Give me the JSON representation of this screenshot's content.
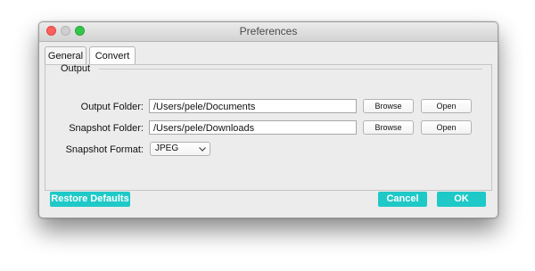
{
  "window": {
    "title": "Preferences",
    "traffic_lights": {
      "close": "close-icon",
      "minimize": "minimize-icon",
      "zoom": "zoom-icon"
    }
  },
  "tabs": [
    {
      "label": "General",
      "selected": true
    },
    {
      "label": "Convert",
      "selected": false
    }
  ],
  "output": {
    "group_label": "Output",
    "output_folder": {
      "label": "Output Folder:",
      "value": "/Users/pele/Documents",
      "browse": "Browse",
      "open": "Open"
    },
    "snapshot_folder": {
      "label": "Snapshot Folder:",
      "value": "/Users/pele/Downloads",
      "browse": "Browse",
      "open": "Open"
    },
    "snapshot_format": {
      "label": "Snapshot Format:",
      "value": "JPEG",
      "icon": "chevron-down-icon"
    }
  },
  "footer": {
    "restore_defaults": "Restore Defaults",
    "cancel": "Cancel",
    "ok": "OK"
  },
  "colors": {
    "accent": "#1ec9c7",
    "close": "#fc605c",
    "zoom": "#34c84a",
    "minimize_inactive": "#cfcfcf"
  }
}
